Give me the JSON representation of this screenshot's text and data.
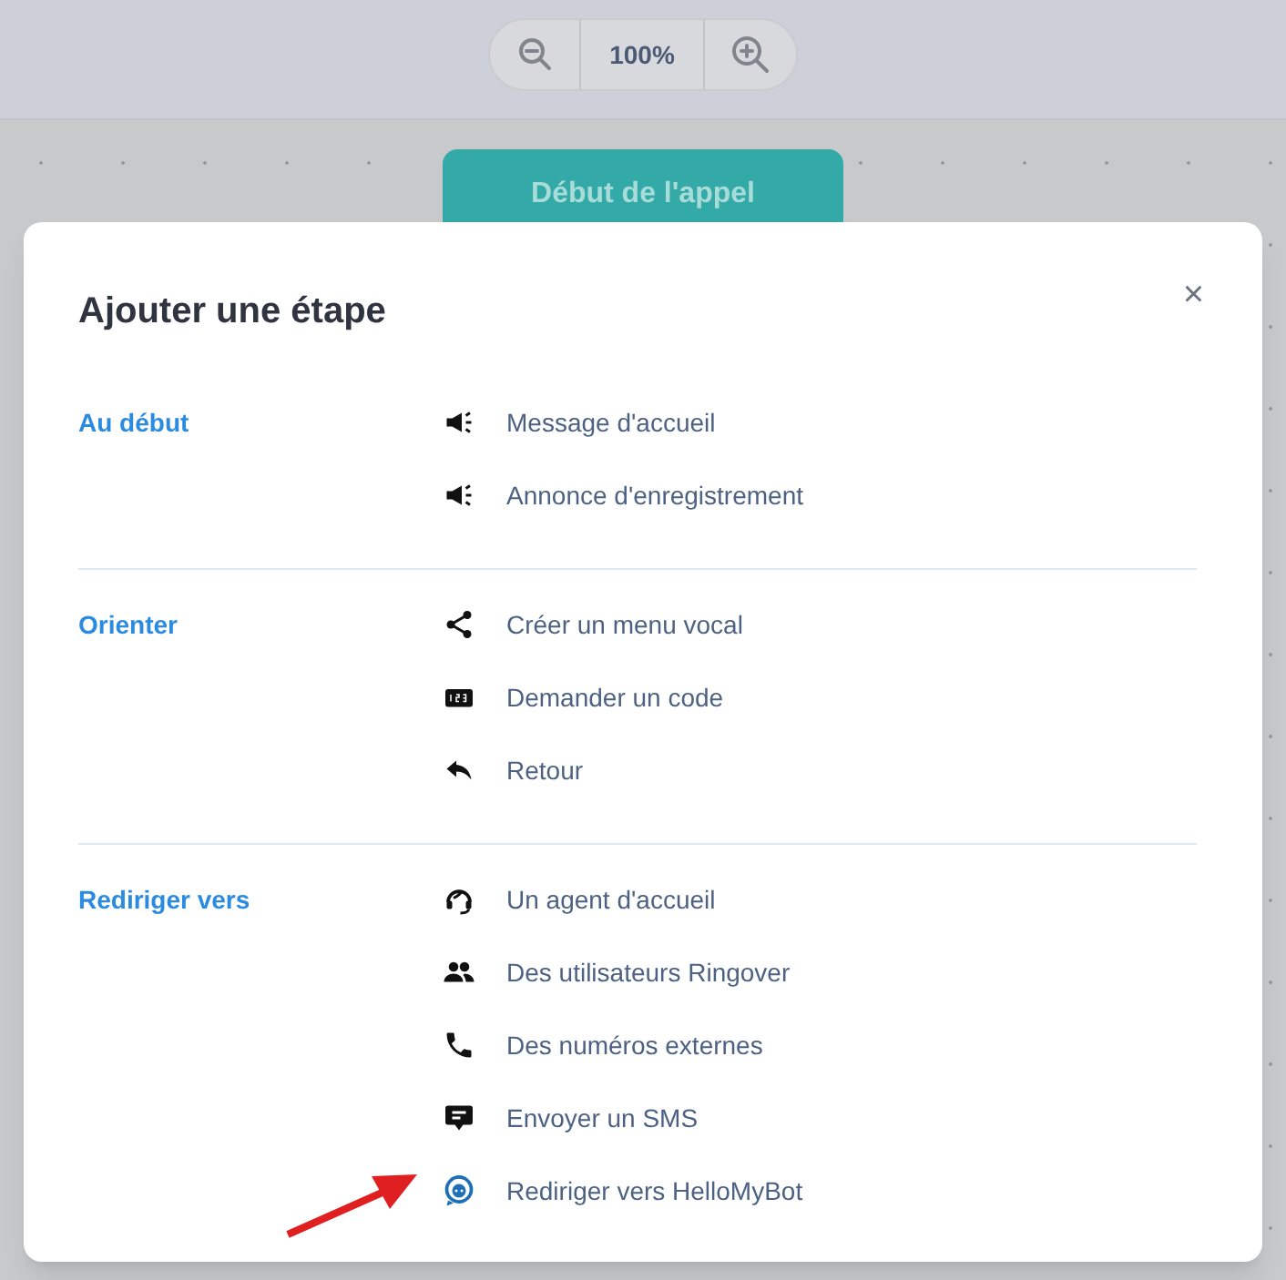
{
  "zoom": {
    "value": "100%"
  },
  "start_node": {
    "label": "Début de l'appel"
  },
  "dialog": {
    "title": "Ajouter une étape",
    "close": "×",
    "sections": [
      {
        "label": "Au début",
        "items": [
          "Message d'accueil",
          "Annonce d'enregistrement"
        ]
      },
      {
        "label": "Orienter",
        "items": [
          "Créer un menu vocal",
          "Demander un code",
          "Retour"
        ]
      },
      {
        "label": "Rediriger vers",
        "items": [
          "Un agent d'accueil",
          "Des utilisateurs Ringover",
          "Des numéros externes",
          "Envoyer un SMS",
          "Rediriger vers HelloMyBot"
        ]
      }
    ]
  }
}
